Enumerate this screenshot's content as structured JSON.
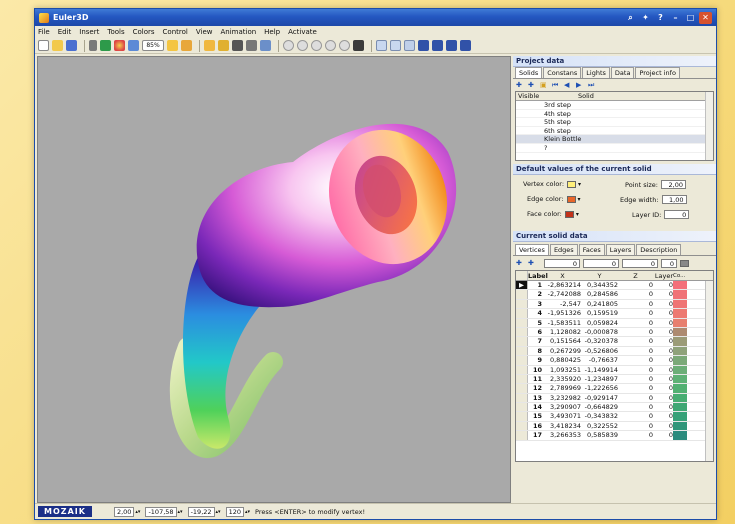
{
  "window": {
    "title": "Euler3D"
  },
  "menu": [
    "File",
    "Edit",
    "Insert",
    "Tools",
    "Colors",
    "Control",
    "View",
    "Animation",
    "Help",
    "Activate"
  ],
  "toolbar": {
    "zoom_value": "85%"
  },
  "project_data": {
    "title": "Project data",
    "tabs": [
      "Solids",
      "Constans",
      "Lights",
      "Data",
      "Project info"
    ],
    "list_headers": [
      "Visible",
      "Solid"
    ],
    "solids": [
      "3rd step",
      "4th step",
      "5th step",
      "6th step",
      "Klein Bottle",
      "?"
    ],
    "selected_index": 4
  },
  "defaults": {
    "title": "Default values of the current solid",
    "vertex_color_label": "Vertex color:",
    "edge_color_label": "Edge color:",
    "face_color_label": "Face color:",
    "point_size_label": "Point size:",
    "point_size_value": "2,00",
    "edge_width_label": "Edge width:",
    "edge_width_value": "1,00",
    "layer_id_label": "Layer ID:",
    "layer_id_value": "0",
    "vertex_color": "#ffef7a",
    "edge_color": "#e8662a",
    "face_color": "#c2321a"
  },
  "current_solid": {
    "title": "Current solid data",
    "tabs": [
      "Vertices",
      "Edges",
      "Faces",
      "Layers",
      "Description"
    ],
    "filter_values": [
      "0",
      "0",
      "0",
      "0"
    ],
    "headers": [
      "Label",
      "X",
      "Y",
      "Z",
      "Layer",
      "Co..."
    ],
    "rows": [
      {
        "label": "1",
        "x": "-2,863214",
        "y": "0,344352",
        "z": "0",
        "layer": "0",
        "color": "#f36f7a"
      },
      {
        "label": "2",
        "x": "-2,742088",
        "y": "0,284586",
        "z": "0",
        "layer": "0",
        "color": "#f07277"
      },
      {
        "label": "3",
        "x": "-2,547",
        "y": "0,241805",
        "z": "0",
        "layer": "0",
        "color": "#ef7474"
      },
      {
        "label": "4",
        "x": "-1,951326",
        "y": "0,159519",
        "z": "0",
        "layer": "0",
        "color": "#ed7971"
      },
      {
        "label": "5",
        "x": "-1,583511",
        "y": "0,059824",
        "z": "0",
        "layer": "0",
        "color": "#e77f6f"
      },
      {
        "label": "6",
        "x": "1,128082",
        "y": "-0,000878",
        "z": "0",
        "layer": "0",
        "color": "#ad8a70"
      },
      {
        "label": "7",
        "x": "0,151564",
        "y": "-0,320378",
        "z": "0",
        "layer": "0",
        "color": "#9b9b77"
      },
      {
        "label": "8",
        "x": "0,267299",
        "y": "-0,526806",
        "z": "0",
        "layer": "0",
        "color": "#8fa27a"
      },
      {
        "label": "9",
        "x": "0,880425",
        "y": "-0,76637",
        "z": "0",
        "layer": "0",
        "color": "#7ba978"
      },
      {
        "label": "10",
        "x": "1,093251",
        "y": "-1,149914",
        "z": "0",
        "layer": "0",
        "color": "#6cae77"
      },
      {
        "label": "11",
        "x": "2,335920",
        "y": "-1,234897",
        "z": "0",
        "layer": "0",
        "color": "#5eb175"
      },
      {
        "label": "12",
        "x": "2,789969",
        "y": "-1,222656",
        "z": "0",
        "layer": "0",
        "color": "#52b072"
      },
      {
        "label": "13",
        "x": "3,232982",
        "y": "-0,929147",
        "z": "0",
        "layer": "0",
        "color": "#47ad72"
      },
      {
        "label": "14",
        "x": "3,290907",
        "y": "-0,664829",
        "z": "0",
        "layer": "0",
        "color": "#3ea774"
      },
      {
        "label": "15",
        "x": "3,493071",
        "y": "-0,343832",
        "z": "0",
        "layer": "0",
        "color": "#36a178"
      },
      {
        "label": "16",
        "x": "3,418234",
        "y": "0,322552",
        "z": "0",
        "layer": "0",
        "color": "#2f967a"
      },
      {
        "label": "17",
        "x": "3,266353",
        "y": "0,585839",
        "z": "0",
        "layer": "0",
        "color": "#2b8b7e"
      }
    ]
  },
  "statusbar": {
    "logo": "MOZAIK",
    "fields": [
      "2,00",
      "-107,58",
      "-19,22",
      "120"
    ],
    "message": "Press <ENTER> to modify vertex!"
  }
}
